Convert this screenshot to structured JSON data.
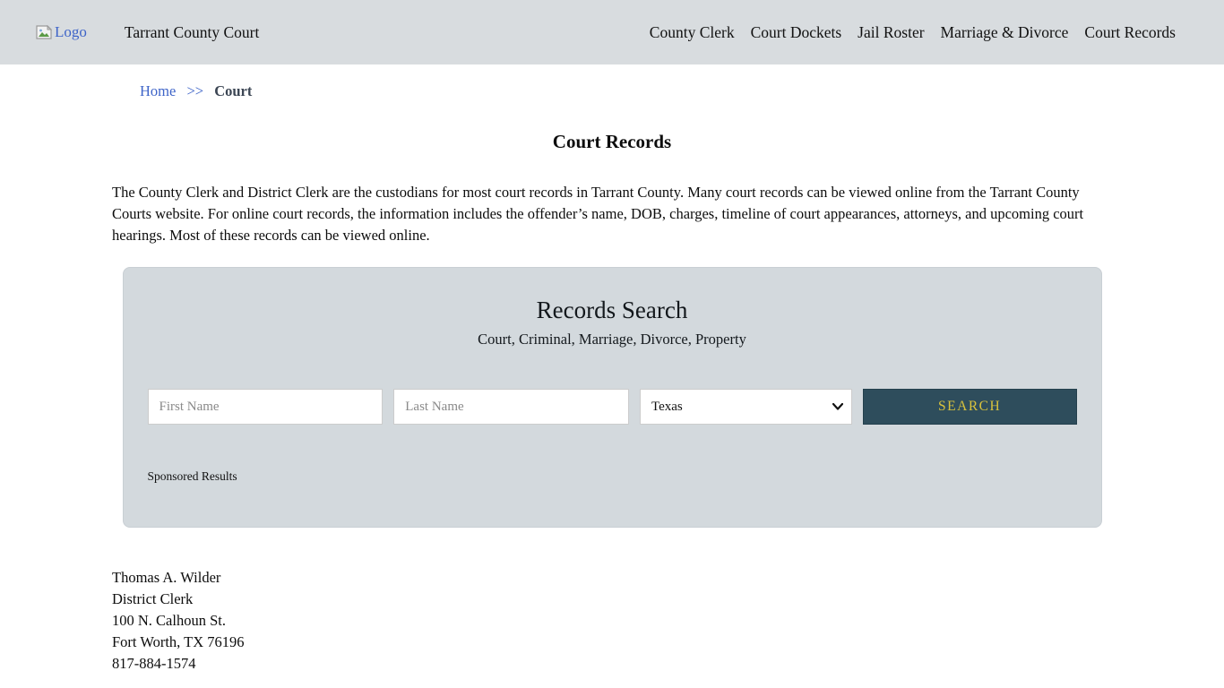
{
  "header": {
    "logo_alt": "Logo",
    "site_title": "Tarrant County Court",
    "nav": [
      {
        "label": "County Clerk"
      },
      {
        "label": "Court Dockets"
      },
      {
        "label": "Jail Roster"
      },
      {
        "label": "Marriage & Divorce"
      },
      {
        "label": "Court Records"
      }
    ]
  },
  "breadcrumb": {
    "home": "Home",
    "separator": ">>",
    "current": "Court"
  },
  "page": {
    "title": "Court Records",
    "intro": "The County Clerk and District Clerk are the custodians for most court records in Tarrant County. Many court records can be viewed online from the Tarrant County Courts website. For online court records, the information includes the offender’s name, DOB, charges, timeline of court appearances, attorneys, and upcoming court hearings. Most of these records can be viewed online."
  },
  "search_panel": {
    "title": "Records Search",
    "subtitle": "Court, Criminal, Marriage, Divorce, Property",
    "first_name_placeholder": "First Name",
    "last_name_placeholder": "Last Name",
    "state_selected": "Texas",
    "search_button_label": "SEARCH",
    "sponsored_label": "Sponsored Results"
  },
  "contact": {
    "lines": [
      "Thomas A. Wilder",
      "District Clerk",
      "100 N. Calhoun St.",
      "Fort Worth, TX 76196",
      "817-884-1574"
    ]
  },
  "colors": {
    "header_bg": "#d8dcdf",
    "panel_bg": "#d3d9dd",
    "link_blue": "#3e64c8",
    "button_bg": "#2e4d5c",
    "button_text": "#d9c33c"
  }
}
